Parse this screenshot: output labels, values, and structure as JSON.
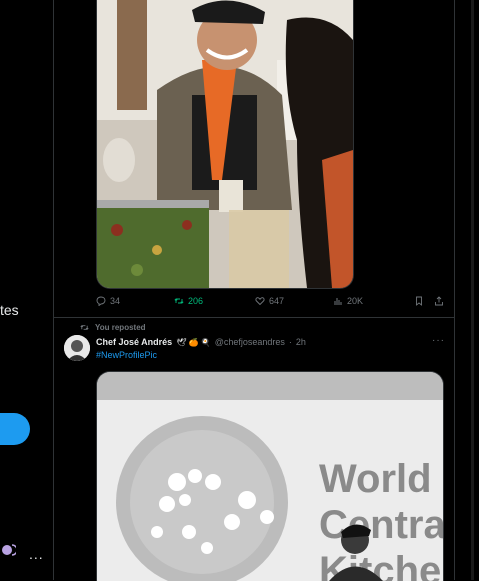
{
  "sidebar": {
    "partial_label": "tes",
    "more_label": "..."
  },
  "post1": {
    "actions": {
      "replies": "34",
      "reposts": "206",
      "likes": "647",
      "views": "20K"
    }
  },
  "post2": {
    "repost_label": "You reposted",
    "author_name": "Chef José Andrés",
    "author_emojis": "🕊 🍊 🍳",
    "author_handle": "@chefjoseandres",
    "separator": "·",
    "time": "2h",
    "more": "···",
    "text": "#NewProfilePic",
    "photo_text_lines": [
      "World",
      "Centra",
      "Kitche"
    ]
  },
  "colors": {
    "accent": "#1d9bf0",
    "repost_green": "#00ba7c",
    "muted": "#71767b",
    "border": "#2f3336"
  }
}
